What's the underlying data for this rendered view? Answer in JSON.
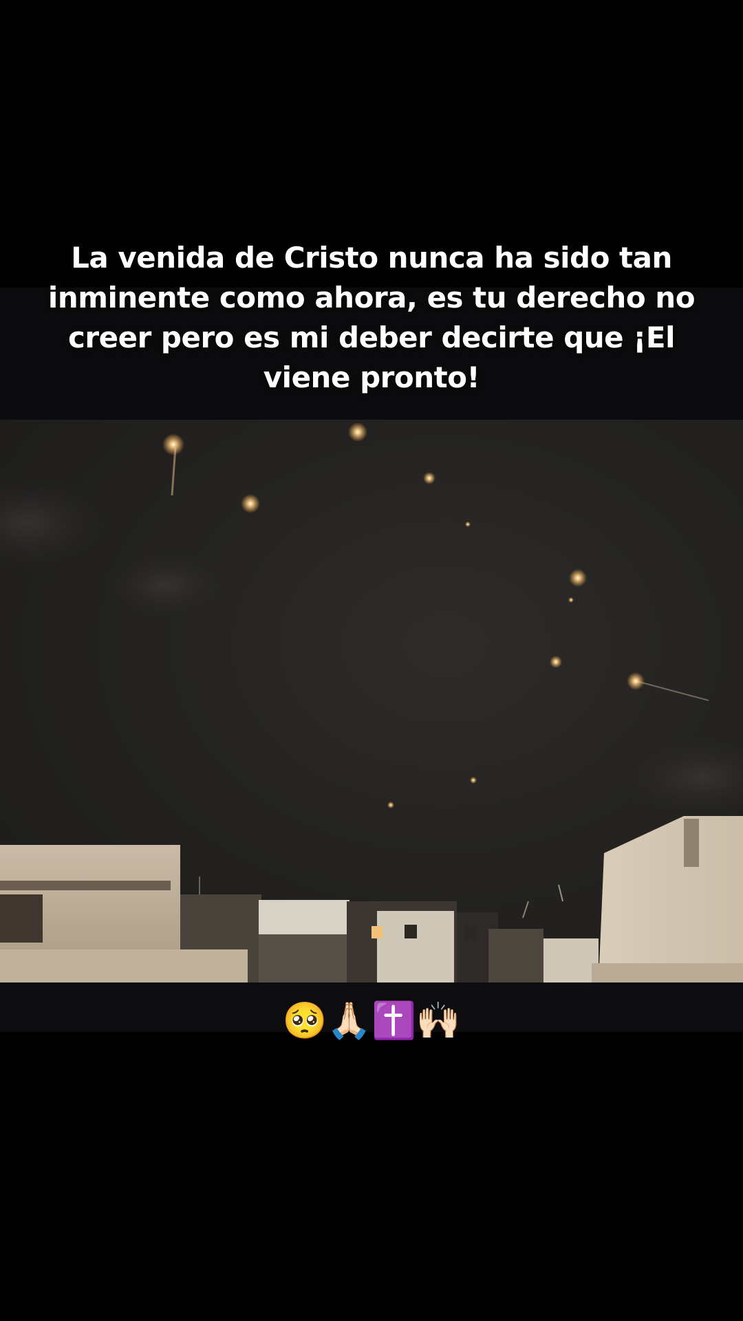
{
  "caption": {
    "text": "La venida de Cristo nunca ha sido tan inminente como ahora, es tu derecho no creer pero es mi deber decirte que ¡El viene pronto!"
  },
  "emoji_caption": {
    "text": "🥺🙏🏻✝️🙌🏻"
  },
  "colors": {
    "background": "#000000",
    "caption_text": "#ffffff",
    "night_sky": "#242321",
    "rooftops": "#d8cbb6",
    "light_glow": "#ffd9a0"
  },
  "scene": {
    "description_icon": "night-sky-lights-over-rooftops",
    "light_count": 11
  }
}
